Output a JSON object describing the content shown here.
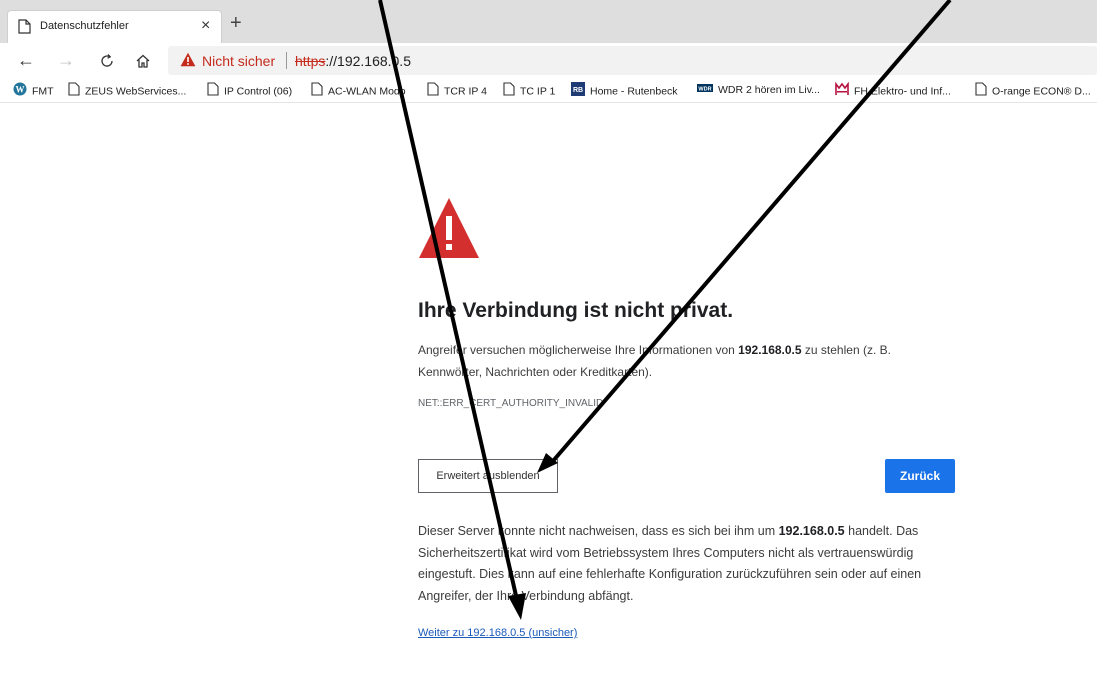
{
  "tab": {
    "title": "Datenschutzfehler",
    "close": "×",
    "new_tab": "+"
  },
  "toolbar": {
    "back": "←",
    "forward": "→",
    "reload": "↻",
    "home": "⌂",
    "security_status": "Nicht sicher",
    "url_scheme": "https",
    "url_rest": "://192.168.0.5"
  },
  "bookmarks": [
    {
      "label": "FMT",
      "icon": "wordpress-icon"
    },
    {
      "label": "ZEUS WebServices...",
      "icon": "page-icon"
    },
    {
      "label": "IP Control (06)",
      "icon": "page-icon"
    },
    {
      "label": "AC-WLAN Modo",
      "icon": "page-icon"
    },
    {
      "label": "TCR IP 4",
      "icon": "page-icon"
    },
    {
      "label": "TC IP 1",
      "icon": "page-icon"
    },
    {
      "label": "Home - Rutenbeck",
      "icon": "rutenbeck-icon"
    },
    {
      "label": "WDR 2 hören im Liv...",
      "icon": "wdr-icon"
    },
    {
      "label": "FH Elektro- und Inf...",
      "icon": "fh-icon"
    },
    {
      "label": "O-range ECON® D...",
      "icon": "page-icon"
    }
  ],
  "content": {
    "heading": "Ihre Verbindung ist nicht privat.",
    "desc_part1": "Angreifer versuchen möglicherweise Ihre Informationen von ",
    "desc_host": "192.168.0.5",
    "desc_part2": " zu stehlen (z. B. Kennwörter, Nachrichten oder Kreditkarten).",
    "error_code": "NET::ERR_CERT_AUTHORITY_INVALID",
    "advanced_button": "Erweitert ausblenden",
    "back_button": "Zurück",
    "details_part1": "Dieser Server konnte nicht nachweisen, dass es sich bei ihm um ",
    "details_host": "192.168.0.5",
    "details_part2": " handelt. Das Sicherheitszertifikat wird vom Betriebssystem Ihres Computers nicht als vertrauenswürdig eingestuft. Dies kann auf eine fehlerhafte Konfiguration zurückzuführen sein oder auf einen Angreifer, der Ihre Verbindung abfängt.",
    "proceed_link": "Weiter zu 192.168.0.5 (unsicher)"
  },
  "colors": {
    "warning_red": "#d32f2f",
    "not_secure_red": "#c42b1c",
    "primary_blue": "#1a73e8",
    "link_blue": "#1a5ab8"
  }
}
